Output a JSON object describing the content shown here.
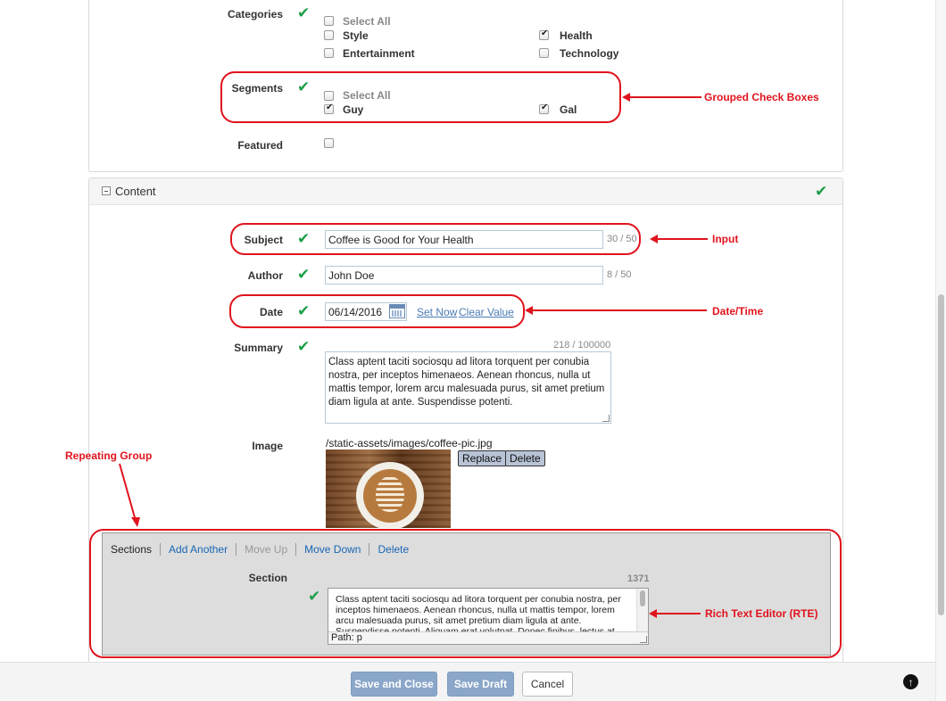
{
  "meta": {
    "categories": {
      "label": "Categories",
      "options": [
        {
          "label": "Select All",
          "checked": false
        },
        {
          "label": "Style",
          "checked": false
        },
        {
          "label": "Health",
          "checked": true
        },
        {
          "label": "Entertainment",
          "checked": false
        },
        {
          "label": "Technology",
          "checked": false
        }
      ]
    },
    "segments": {
      "label": "Segments",
      "options": [
        {
          "label": "Select All",
          "checked": false
        },
        {
          "label": "Guy",
          "checked": true
        },
        {
          "label": "Gal",
          "checked": true
        }
      ]
    },
    "featured": {
      "label": "Featured",
      "checked": false
    }
  },
  "content": {
    "section_title": "Content",
    "toggle_icon": "minus-square-icon",
    "subject": {
      "label": "Subject",
      "value": "Coffee is Good for Your Health",
      "count": "30 / 50"
    },
    "author": {
      "label": "Author",
      "value": "John Doe",
      "count": "8 / 50"
    },
    "date": {
      "label": "Date",
      "value": "06/14/2016",
      "set_now": "Set Now",
      "clear_value": "Clear Value"
    },
    "summary": {
      "label": "Summary",
      "count": "218 / 100000",
      "text": "Class aptent taciti sociosqu ad litora torquent per conubia nostra, per inceptos himenaeos. Aenean rhoncus, nulla ut mattis tempor, lorem arcu malesuada purus, sit amet pretium diam ligula at ante. Suspendisse potenti."
    },
    "image": {
      "label": "Image",
      "path": "/static-assets/images/coffee-pic.jpg",
      "replace": "Replace",
      "delete": "Delete"
    }
  },
  "repeating_group": {
    "toolbar": {
      "title": "Sections",
      "add_another": "Add Another",
      "move_up": "Move Up",
      "move_down": "Move Down",
      "delete": "Delete"
    },
    "section_label": "Section",
    "count": "1371",
    "rte_text": "Class aptent taciti sociosqu ad litora torquent per conubia nostra, per inceptos himenaeos. Aenean rhoncus, nulla ut mattis tempor, lorem arcu malesuada purus, sit amet pretium diam ligula at ante. Suspendisse potenti. Aliquam erat volutpat. Donec finibus, lectus at",
    "rte_path": "Path: p"
  },
  "annotations": {
    "grouped": "Grouped Check Boxes",
    "input": "Input",
    "datetime": "Date/Time",
    "repeating": "Repeating Group",
    "rte": "Rich Text Editor (RTE)"
  },
  "footer": {
    "save_close": "Save and Close",
    "save_draft": "Save Draft",
    "cancel": "Cancel",
    "help": "?"
  },
  "colors": {
    "valid_check": "#1e9e4a",
    "annotation": "#e0141e",
    "primary_button": "#8aa6c9",
    "link": "#4a7bb5"
  }
}
